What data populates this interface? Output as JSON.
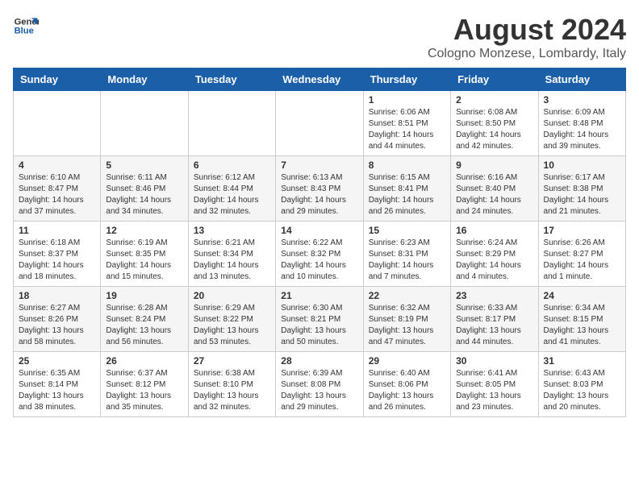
{
  "logo": {
    "text_general": "General",
    "text_blue": "Blue"
  },
  "header": {
    "month": "August 2024",
    "location": "Cologno Monzese, Lombardy, Italy"
  },
  "weekdays": [
    "Sunday",
    "Monday",
    "Tuesday",
    "Wednesday",
    "Thursday",
    "Friday",
    "Saturday"
  ],
  "weeks": [
    [
      {
        "day": "",
        "info": ""
      },
      {
        "day": "",
        "info": ""
      },
      {
        "day": "",
        "info": ""
      },
      {
        "day": "",
        "info": ""
      },
      {
        "day": "1",
        "info": "Sunrise: 6:06 AM\nSunset: 8:51 PM\nDaylight: 14 hours\nand 44 minutes."
      },
      {
        "day": "2",
        "info": "Sunrise: 6:08 AM\nSunset: 8:50 PM\nDaylight: 14 hours\nand 42 minutes."
      },
      {
        "day": "3",
        "info": "Sunrise: 6:09 AM\nSunset: 8:48 PM\nDaylight: 14 hours\nand 39 minutes."
      }
    ],
    [
      {
        "day": "4",
        "info": "Sunrise: 6:10 AM\nSunset: 8:47 PM\nDaylight: 14 hours\nand 37 minutes."
      },
      {
        "day": "5",
        "info": "Sunrise: 6:11 AM\nSunset: 8:46 PM\nDaylight: 14 hours\nand 34 minutes."
      },
      {
        "day": "6",
        "info": "Sunrise: 6:12 AM\nSunset: 8:44 PM\nDaylight: 14 hours\nand 32 minutes."
      },
      {
        "day": "7",
        "info": "Sunrise: 6:13 AM\nSunset: 8:43 PM\nDaylight: 14 hours\nand 29 minutes."
      },
      {
        "day": "8",
        "info": "Sunrise: 6:15 AM\nSunset: 8:41 PM\nDaylight: 14 hours\nand 26 minutes."
      },
      {
        "day": "9",
        "info": "Sunrise: 6:16 AM\nSunset: 8:40 PM\nDaylight: 14 hours\nand 24 minutes."
      },
      {
        "day": "10",
        "info": "Sunrise: 6:17 AM\nSunset: 8:38 PM\nDaylight: 14 hours\nand 21 minutes."
      }
    ],
    [
      {
        "day": "11",
        "info": "Sunrise: 6:18 AM\nSunset: 8:37 PM\nDaylight: 14 hours\nand 18 minutes."
      },
      {
        "day": "12",
        "info": "Sunrise: 6:19 AM\nSunset: 8:35 PM\nDaylight: 14 hours\nand 15 minutes."
      },
      {
        "day": "13",
        "info": "Sunrise: 6:21 AM\nSunset: 8:34 PM\nDaylight: 14 hours\nand 13 minutes."
      },
      {
        "day": "14",
        "info": "Sunrise: 6:22 AM\nSunset: 8:32 PM\nDaylight: 14 hours\nand 10 minutes."
      },
      {
        "day": "15",
        "info": "Sunrise: 6:23 AM\nSunset: 8:31 PM\nDaylight: 14 hours\nand 7 minutes."
      },
      {
        "day": "16",
        "info": "Sunrise: 6:24 AM\nSunset: 8:29 PM\nDaylight: 14 hours\nand 4 minutes."
      },
      {
        "day": "17",
        "info": "Sunrise: 6:26 AM\nSunset: 8:27 PM\nDaylight: 14 hours\nand 1 minute."
      }
    ],
    [
      {
        "day": "18",
        "info": "Sunrise: 6:27 AM\nSunset: 8:26 PM\nDaylight: 13 hours\nand 58 minutes."
      },
      {
        "day": "19",
        "info": "Sunrise: 6:28 AM\nSunset: 8:24 PM\nDaylight: 13 hours\nand 56 minutes."
      },
      {
        "day": "20",
        "info": "Sunrise: 6:29 AM\nSunset: 8:22 PM\nDaylight: 13 hours\nand 53 minutes."
      },
      {
        "day": "21",
        "info": "Sunrise: 6:30 AM\nSunset: 8:21 PM\nDaylight: 13 hours\nand 50 minutes."
      },
      {
        "day": "22",
        "info": "Sunrise: 6:32 AM\nSunset: 8:19 PM\nDaylight: 13 hours\nand 47 minutes."
      },
      {
        "day": "23",
        "info": "Sunrise: 6:33 AM\nSunset: 8:17 PM\nDaylight: 13 hours\nand 44 minutes."
      },
      {
        "day": "24",
        "info": "Sunrise: 6:34 AM\nSunset: 8:15 PM\nDaylight: 13 hours\nand 41 minutes."
      }
    ],
    [
      {
        "day": "25",
        "info": "Sunrise: 6:35 AM\nSunset: 8:14 PM\nDaylight: 13 hours\nand 38 minutes."
      },
      {
        "day": "26",
        "info": "Sunrise: 6:37 AM\nSunset: 8:12 PM\nDaylight: 13 hours\nand 35 minutes."
      },
      {
        "day": "27",
        "info": "Sunrise: 6:38 AM\nSunset: 8:10 PM\nDaylight: 13 hours\nand 32 minutes."
      },
      {
        "day": "28",
        "info": "Sunrise: 6:39 AM\nSunset: 8:08 PM\nDaylight: 13 hours\nand 29 minutes."
      },
      {
        "day": "29",
        "info": "Sunrise: 6:40 AM\nSunset: 8:06 PM\nDaylight: 13 hours\nand 26 minutes."
      },
      {
        "day": "30",
        "info": "Sunrise: 6:41 AM\nSunset: 8:05 PM\nDaylight: 13 hours\nand 23 minutes."
      },
      {
        "day": "31",
        "info": "Sunrise: 6:43 AM\nSunset: 8:03 PM\nDaylight: 13 hours\nand 20 minutes."
      }
    ]
  ]
}
